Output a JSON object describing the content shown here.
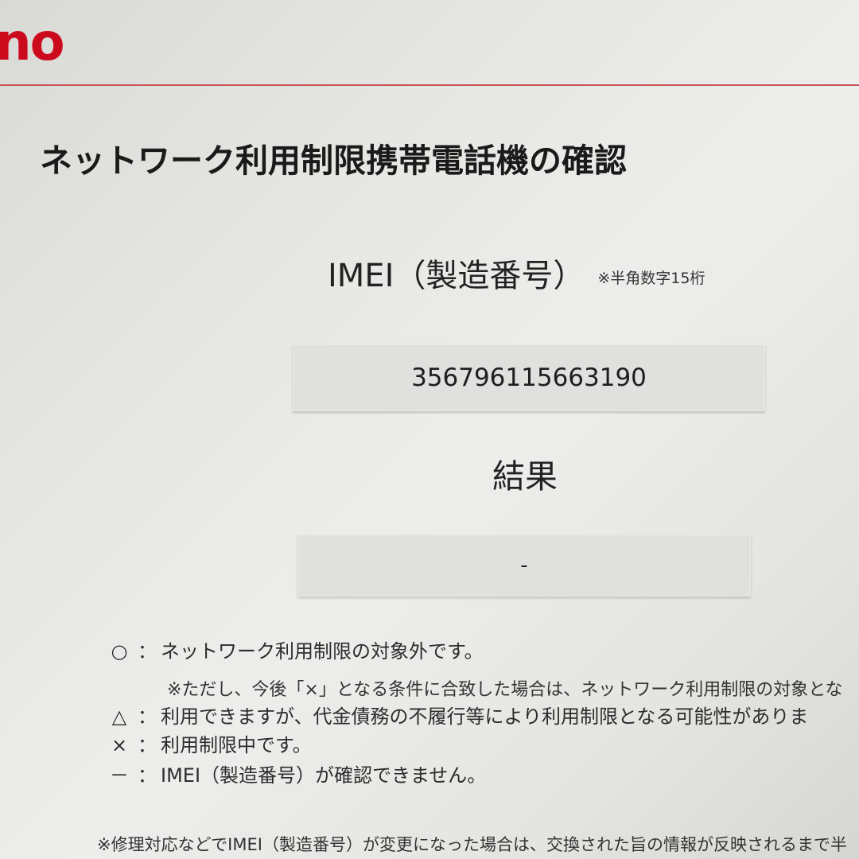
{
  "brand": {
    "logo_text": "no",
    "accent_color": "#cc0a1e"
  },
  "page": {
    "title": "ネットワーク利用制限携帯電話機の確認"
  },
  "imei": {
    "label": "IMEI（製造番号）",
    "note": "※半角数字15桁",
    "value": "356796115663190"
  },
  "result": {
    "label": "結果",
    "value": "-"
  },
  "legend": [
    {
      "mark": "○",
      "colon": "：",
      "text": "ネットワーク利用制限の対象外です。"
    },
    {
      "mark": "△",
      "colon": "：",
      "text": "利用できますが、代金債務の不履行等により利用制限となる可能性がありま"
    },
    {
      "mark": "×",
      "colon": "：",
      "text": "利用制限中です。"
    },
    {
      "mark": "－",
      "colon": "：",
      "text": "IMEI（製造番号）が確認できません。"
    }
  ],
  "legend_note": "※ただし、今後「×」となる条件に合致した場合は、ネットワーク利用制限の対象とな",
  "footnote": "※修理対応などでIMEI（製造番号）が変更になった場合は、交換された旨の情報が反映されるまで半"
}
